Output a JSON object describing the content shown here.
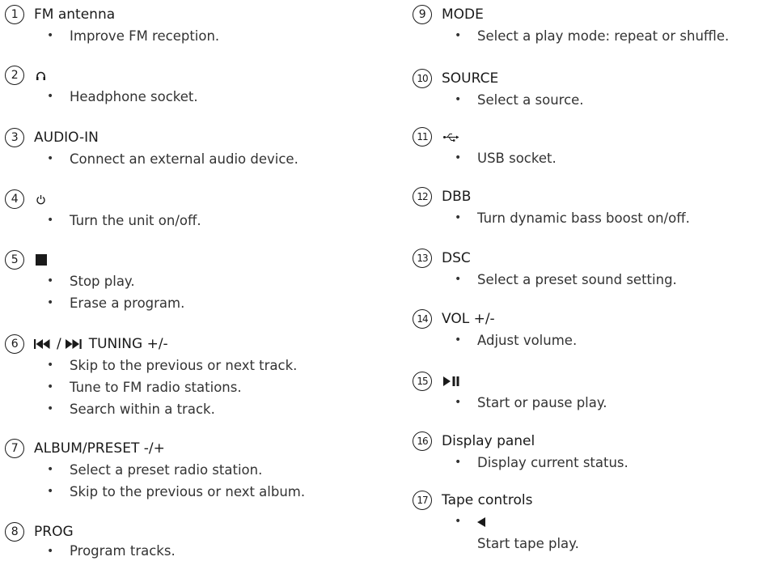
{
  "left": [
    {
      "num": "1",
      "title": "FM antenna",
      "bullets": [
        "Improve FM reception."
      ]
    },
    {
      "num": "2",
      "icon": "headphone-icon",
      "bullets": [
        "Headphone socket."
      ]
    },
    {
      "num": "3",
      "title": "AUDIO-IN",
      "bullets": [
        "Connect an external audio device."
      ]
    },
    {
      "num": "4",
      "icon": "power-icon",
      "bullets": [
        "Turn the unit on/off."
      ]
    },
    {
      "num": "5",
      "icon": "stop-icon",
      "bullets": [
        "Stop play.",
        "Erase a program."
      ]
    },
    {
      "num": "6",
      "title": "TUNING +/-",
      "separator": "/",
      "icon": "prev-next-icon",
      "bullets": [
        "Skip to the previous or next track.",
        "Tune to FM radio stations.",
        "Search within a track."
      ]
    },
    {
      "num": "7",
      "title": "ALBUM/PRESET -/+",
      "bullets": [
        "Select a preset radio station.",
        "Skip to the previous or next album."
      ]
    },
    {
      "num": "8",
      "title": "PROG",
      "bullets": [
        "Program tracks."
      ]
    }
  ],
  "right": [
    {
      "num": "9",
      "title": "MODE",
      "bullets": [
        "Select a play mode: repeat or shuffle."
      ]
    },
    {
      "num": "10",
      "title": "SOURCE",
      "bullets": [
        "Select a source."
      ]
    },
    {
      "num": "11",
      "icon": "usb-icon",
      "bullets": [
        "USB socket."
      ]
    },
    {
      "num": "12",
      "title": "DBB",
      "bullets": [
        "Turn dynamic bass boost on/off."
      ]
    },
    {
      "num": "13",
      "title": "DSC",
      "bullets": [
        "Select a preset sound setting."
      ]
    },
    {
      "num": "14",
      "title": "VOL +/-",
      "bullets": [
        "Adjust volume."
      ]
    },
    {
      "num": "15",
      "icon": "play-pause-icon",
      "bullets": [
        "Start or pause play."
      ]
    },
    {
      "num": "16",
      "title": "Display panel",
      "bullets": [
        "Display current status."
      ]
    },
    {
      "num": "17",
      "title": "Tape controls",
      "icon_bullet": "play-reverse-icon",
      "sub": "Start tape play."
    }
  ]
}
